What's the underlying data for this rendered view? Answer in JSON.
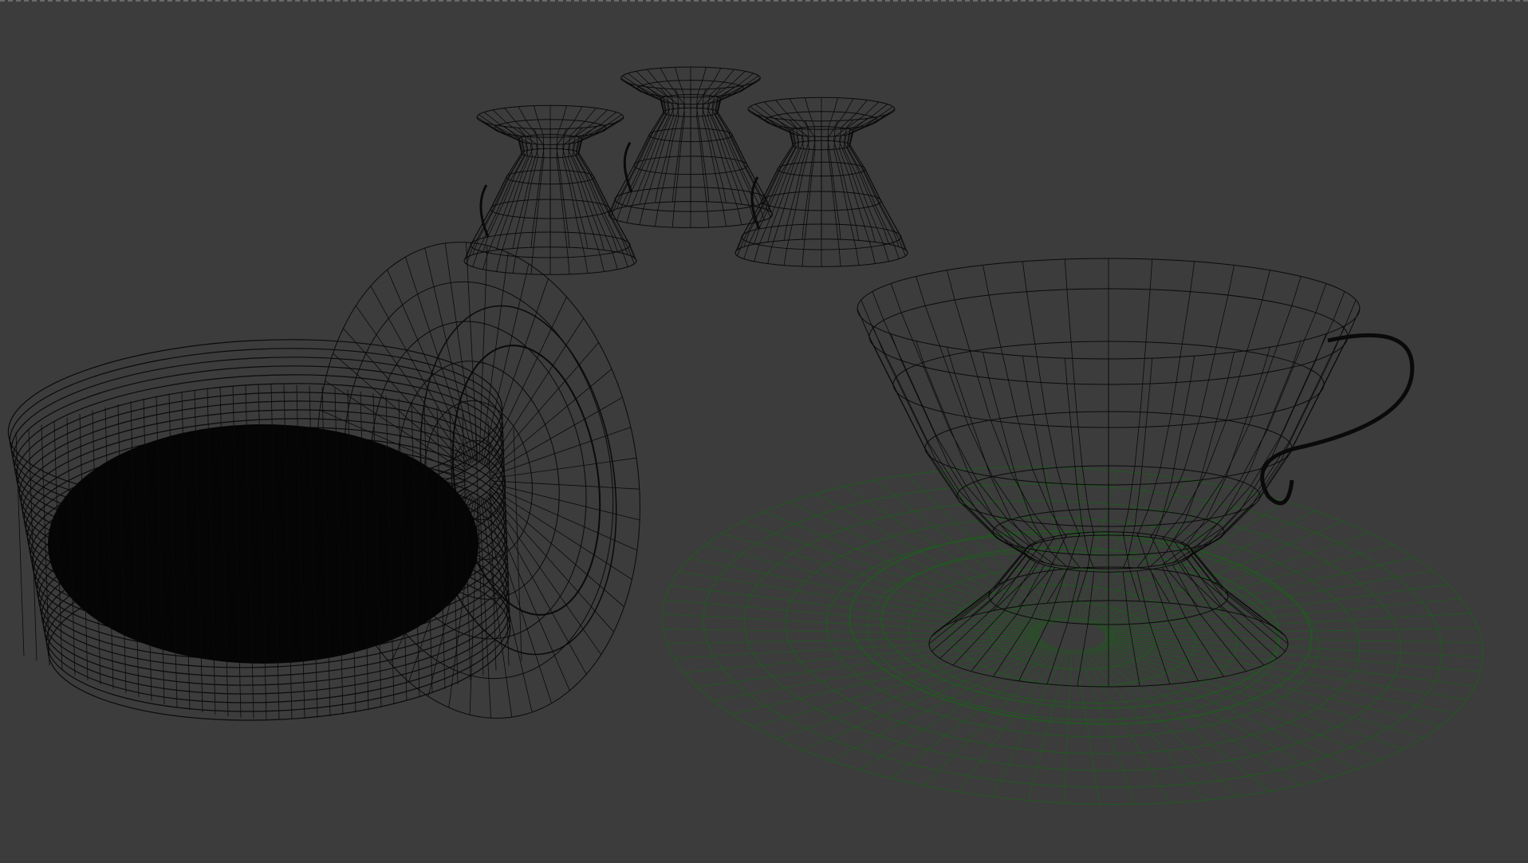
{
  "viewport": {
    "background": "#3c3c3c",
    "wire_color": "#0a0a0a",
    "selected_wire_color": "#1f5a1f",
    "objects": [
      {
        "name": "upside-down-cup-left",
        "selected": false
      },
      {
        "name": "upside-down-cup-middle",
        "selected": false
      },
      {
        "name": "upside-down-cup-right",
        "selected": false
      },
      {
        "name": "standing-saucer",
        "selected": false
      },
      {
        "name": "saucer-stack",
        "selected": false
      },
      {
        "name": "teacup",
        "selected": false
      },
      {
        "name": "saucer-under-teacup",
        "selected": true
      }
    ]
  }
}
